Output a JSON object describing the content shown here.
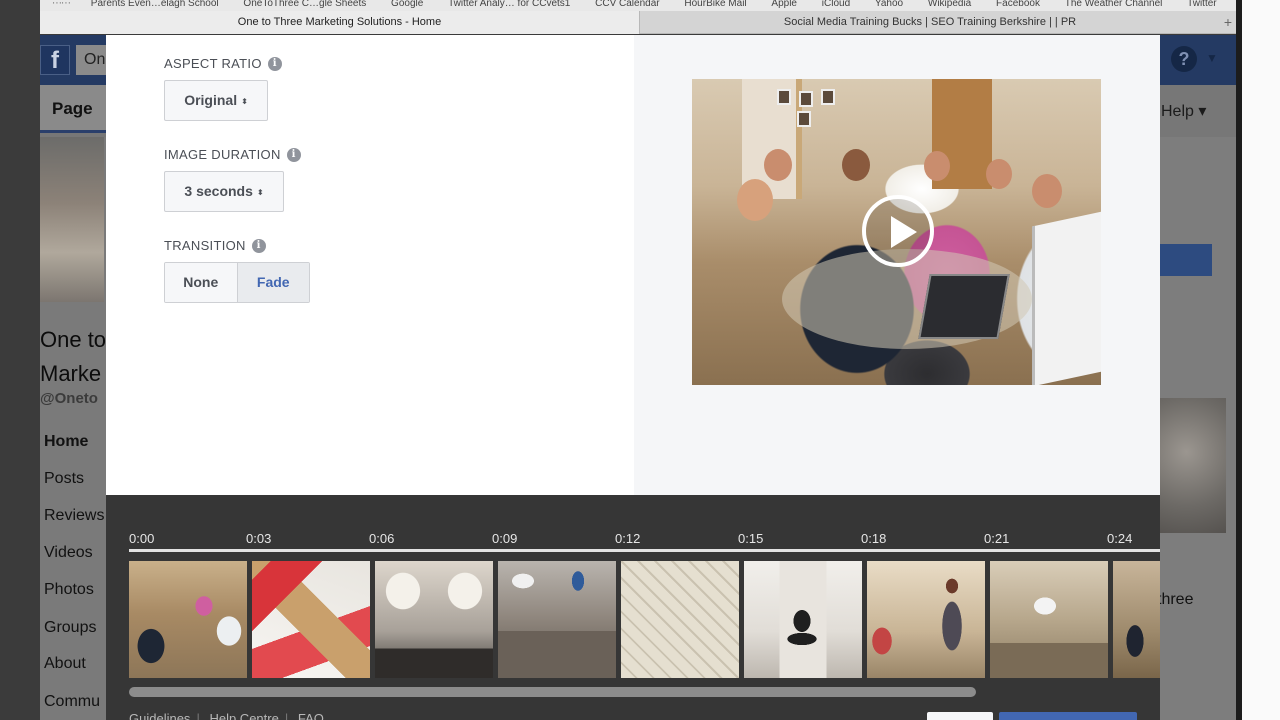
{
  "browser": {
    "bookmarks": [
      "Parents Even…elagh School",
      "OneToThree C…gle Sheets",
      "Google",
      "Twitter Analy… for CCvets1",
      "CCV Calendar",
      "HourBike Mail",
      "Apple",
      "iCloud",
      "Yahoo",
      "Wikipedia",
      "Facebook",
      "The Weather Channel",
      "Twitter"
    ],
    "tabs": [
      {
        "title": "One to Three Marketing Solutions - Home",
        "active": true
      },
      {
        "title": "Social Media Training Bucks | SEO Training Berkshire | | PR",
        "active": false
      }
    ],
    "new_tab_symbol": "+"
  },
  "facebook_bg": {
    "logo": "f",
    "search_text": "On",
    "help_icon": "?",
    "page_tab": "Page",
    "help_link": "Help ▾",
    "page_name_line1": "One to",
    "page_name_line2": "Marke",
    "handle": "@Oneto",
    "sidebar": [
      "Home",
      "Posts",
      "Reviews",
      "Videos",
      "Photos",
      "Groups",
      "About",
      "Commu"
    ],
    "right_text": "three"
  },
  "settings": {
    "aspect_ratio": {
      "label": "ASPECT RATIO",
      "value": "Original"
    },
    "image_duration": {
      "label": "IMAGE DURATION",
      "value": "3 seconds"
    },
    "transition": {
      "label": "TRANSITION",
      "options": [
        "None",
        "Fade"
      ],
      "selected": "Fade"
    },
    "info_glyph": "i",
    "caret_glyph": "⬍"
  },
  "timeline": {
    "time_marks": [
      "0:00",
      "0:03",
      "0:06",
      "0:09",
      "0:12",
      "0:15",
      "0:18",
      "0:21",
      "0:24"
    ],
    "thumbnails": [
      "team-meeting",
      "lead-blocks",
      "coffee-cups",
      "office-desk",
      "back-to-school-scrabble",
      "dog-in-hallway",
      "woman-presenting",
      "office-room",
      "partial-photo"
    ],
    "scroll_fraction": 0.82
  },
  "footer": {
    "links": [
      "Guidelines",
      "Help Centre",
      "FAQ"
    ]
  }
}
